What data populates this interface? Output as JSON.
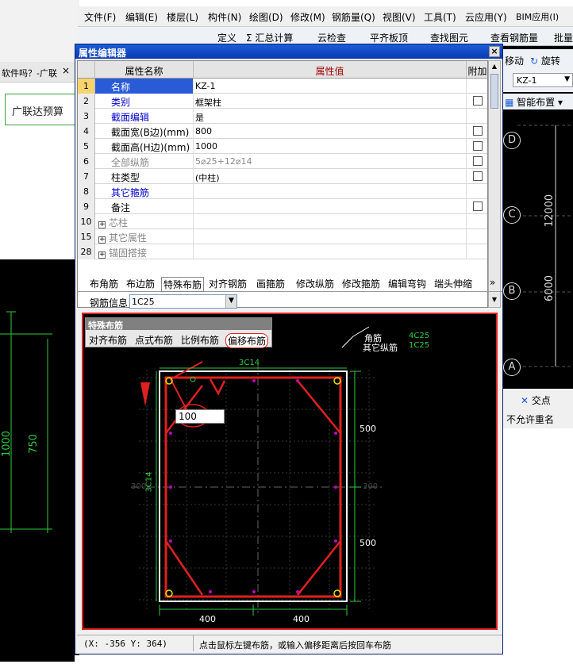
{
  "browser": {
    "tab_text": "软件吗？-广联",
    "tab_close": "×",
    "search_text": "广联达预算",
    "left_dims": [
      "1000",
      "750"
    ]
  },
  "app": {
    "menu": [
      "文件(F)",
      "编辑(E)",
      "楼层(L)",
      "构件(N)",
      "绘图(D)",
      "修改(M)",
      "钢筋量(Q)",
      "视图(V)",
      "工具(T)",
      "云应用(Y)",
      "BIM应用(I)"
    ],
    "toolbar": [
      "定义",
      "Σ 汇总计算",
      "云检查",
      "平齐板顶",
      "查找图元",
      "查看钢筋量",
      "批量"
    ],
    "right_tools": [
      "移动",
      "旋转",
      "KZ-1",
      "智能布置"
    ],
    "axis_labels": [
      "D",
      "C",
      "B",
      "A"
    ],
    "right_dims": [
      "12000",
      "6000"
    ],
    "bottom_right_tools": [
      "交点",
      "不允许重名"
    ]
  },
  "dialog": {
    "title": "属性编辑器",
    "close": "×",
    "columns": [
      "属性名称",
      "属性值",
      "附加"
    ],
    "rows": [
      {
        "n": "1",
        "name": "名称",
        "value": "KZ-1",
        "check": false,
        "style": "normal",
        "selected": true
      },
      {
        "n": "2",
        "name": "类别",
        "value": "框架柱",
        "check": true,
        "style": "blue"
      },
      {
        "n": "3",
        "name": "截面编辑",
        "value": "是",
        "check": false,
        "style": "blue"
      },
      {
        "n": "4",
        "name": "截面宽(B边)(mm)",
        "value": "800",
        "check": true,
        "style": "normal"
      },
      {
        "n": "5",
        "name": "截面高(H边)(mm)",
        "value": "1000",
        "check": true,
        "style": "normal"
      },
      {
        "n": "6",
        "name": "全部纵筋",
        "value": "5⌀25+12⌀14",
        "check": true,
        "style": "gray"
      },
      {
        "n": "7",
        "name": "柱类型",
        "value": "(中柱)",
        "check": true,
        "style": "normal"
      },
      {
        "n": "8",
        "name": "其它箍筋",
        "value": "",
        "check": false,
        "style": "blue"
      },
      {
        "n": "9",
        "name": "备注",
        "value": "",
        "check": true,
        "style": "normal"
      },
      {
        "n": "10",
        "name": "芯柱",
        "value": "",
        "check": false,
        "style": "tree"
      },
      {
        "n": "15",
        "name": "其它属性",
        "value": "",
        "check": false,
        "style": "tree"
      },
      {
        "n": "28",
        "name": "锚固搭接",
        "value": "",
        "check": false,
        "style": "tree"
      }
    ],
    "tabs": [
      "布角筋",
      "布边筋",
      "特殊布筋",
      "对齐钢筋",
      "画箍筋",
      "修改纵筋",
      "修改箍筋",
      "编辑弯钩",
      "端头伸缩"
    ],
    "tabs_more": "»",
    "info_label": "钢筋信息",
    "info_value": "1C25",
    "popup": {
      "title": "特殊布筋",
      "items": [
        "对齐布筋",
        "点式布筋",
        "比例布筋",
        "偏移布筋"
      ]
    },
    "canvas": {
      "corner_label": "角筋",
      "corner_value": "4C25",
      "other_label": "其它纵筋",
      "other_value": "1C25",
      "top_label": "3C14",
      "left_label": "3C14",
      "offset_input": "100",
      "dim_right_top": "500",
      "dim_right_bottom": "500",
      "dim_bottom_left": "400",
      "dim_bottom_right": "400",
      "mid_left": "300",
      "mid_right": "300"
    },
    "status": {
      "coords": "(X: -356 Y: 364)",
      "message": "点击鼠标左键布筋，或输入偏移距离后按回车布筋"
    }
  }
}
